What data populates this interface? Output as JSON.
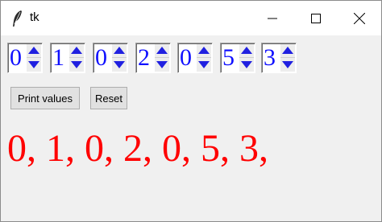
{
  "window": {
    "title": "tk"
  },
  "spinboxes": [
    {
      "value": "0"
    },
    {
      "value": "1"
    },
    {
      "value": "0"
    },
    {
      "value": "2"
    },
    {
      "value": "0"
    },
    {
      "value": "5"
    },
    {
      "value": "3"
    }
  ],
  "buttons": {
    "print_label": "Print values",
    "reset_label": "Reset"
  },
  "output": {
    "text": "0, 1, 0, 2, 0, 5, 3,"
  },
  "colors": {
    "spin_text": "#1010ff",
    "spin_arrow": "#2020e0",
    "output_text": "#ff0000"
  },
  "icons": {
    "app": "feather-icon",
    "minimize": "minimize-icon",
    "maximize": "maximize-icon",
    "close": "close-icon"
  }
}
